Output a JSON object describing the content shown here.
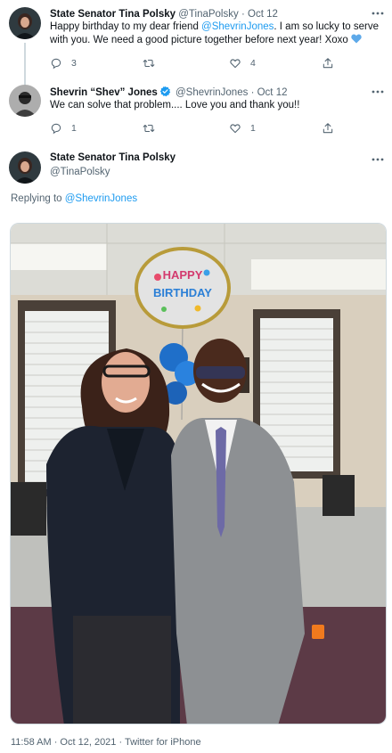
{
  "tweet1": {
    "name": "State Senator Tina Polsky",
    "handle": "@TinaPolsky",
    "separator": "·",
    "time": "Oct 12",
    "text_before": "Happy birthday to my dear friend ",
    "mention": "@ShevrinJones",
    "text_after": ". I am so lucky to serve with you. We need a good picture together before next year! Xoxo ",
    "emoji": "💙",
    "reply_count": "3",
    "like_count": "4"
  },
  "tweet2": {
    "name": "Shevrin “Shev” Jones",
    "handle": "@ShevrinJones",
    "separator": "·",
    "time": "Oct 12",
    "text": "We can solve that problem.... Love you and thank you!!",
    "reply_count": "1",
    "like_count": "1"
  },
  "main_tweet": {
    "name": "State Senator Tina Polsky",
    "handle": "@TinaPolsky",
    "replying_label": "Replying to ",
    "replying_handle": "@ShevrinJones",
    "timestamp": "11:58 AM · Oct 12, 2021 · Twitter for iPhone",
    "photo_balloon_text": "HAPPY BIRTHDAY"
  },
  "colors": {
    "link": "#1d9bf0",
    "secondary_text": "#536471",
    "verified_badge": "#1d9bf0",
    "thread_line": "#cfd9de"
  },
  "icons": {
    "reply": "reply-icon",
    "retweet": "retweet-icon",
    "like": "heart-icon",
    "share": "share-icon",
    "more": "more-icon",
    "verified": "verified-badge-icon"
  }
}
